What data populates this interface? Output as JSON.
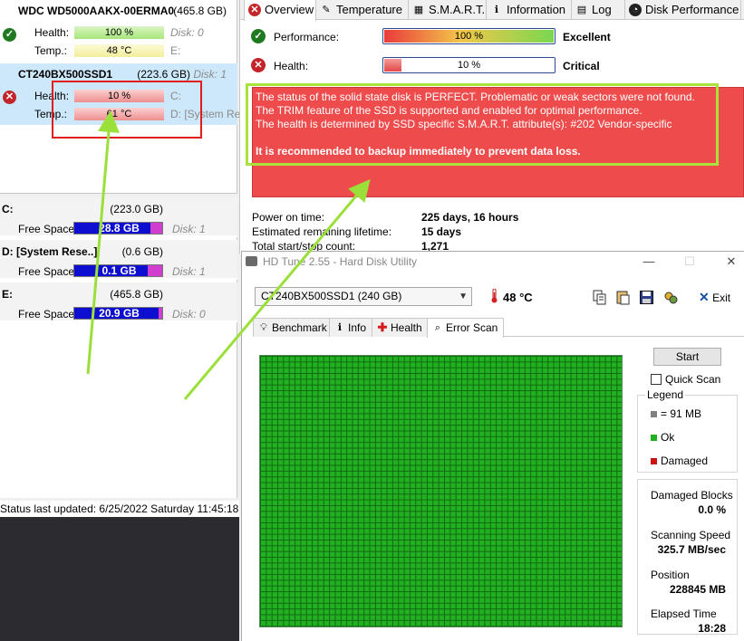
{
  "disks": [
    {
      "title": "WDC WD5000AAKX-00ERMA0",
      "size": "(465.8 GB)",
      "disk_label": "",
      "health_label": "Health:",
      "health_value": "100 %",
      "health_extra": "Disk: 0",
      "temp_label": "Temp.:",
      "temp_value": "48 °C",
      "temp_extra": "E:"
    },
    {
      "title": "CT240BX500SSD1",
      "size": "(223.6 GB)",
      "disk_label": "Disk: 1",
      "health_label": "Health:",
      "health_value": "10 %",
      "health_extra": "C:",
      "temp_label": "Temp.:",
      "temp_value": "61 °C",
      "temp_extra": "D: [System Re"
    }
  ],
  "partitions": [
    {
      "name": "C:",
      "size": "(223.0 GB)",
      "free_label": "Free Space",
      "free_value": "28.8 GB",
      "fill_percent": 87,
      "disk": "Disk: 1"
    },
    {
      "name": "D: [System Rese..]",
      "size": "(0.6 GB)",
      "free_label": "Free Space",
      "free_value": "0.1 GB",
      "fill_percent": 83,
      "disk": "Disk: 1"
    },
    {
      "name": "E:",
      "size": "(465.8 GB)",
      "free_label": "Free Space",
      "free_value": "20.9 GB",
      "fill_percent": 96,
      "disk": "Disk: 0"
    }
  ],
  "status_bar": "Status last updated: 6/25/2022 Saturday 11:45:18 AM",
  "tabs": [
    {
      "label": "Overview",
      "icon": "error-icon"
    },
    {
      "label": "Temperature",
      "icon": "thermometer-icon"
    },
    {
      "label": "S.M.A.R.T.",
      "icon": "smart-icon"
    },
    {
      "label": "Information",
      "icon": "info-icon"
    },
    {
      "label": "Log",
      "icon": "log-icon"
    },
    {
      "label": "Disk Performance",
      "icon": "speedometer-icon"
    }
  ],
  "performance": {
    "label": "Performance:",
    "value": "100 %",
    "percent": 100,
    "verdict": "Excellent"
  },
  "health": {
    "label": "Health:",
    "value": "10 %",
    "percent": 10,
    "verdict": "Critical"
  },
  "status_message": {
    "line1": "The status of the solid state disk is PERFECT. Problematic or weak sectors were not found.",
    "line2": "The TRIM feature of the SSD is supported and enabled for optimal performance.",
    "line3": "The health is determined by SSD specific S.M.A.R.T. attribute(s):  #202 Vendor-specific",
    "line4": "It is recommended to backup immediately to prevent data loss."
  },
  "info": {
    "power_on_label": "Power on time:",
    "power_on_value": "225 days, 16 hours",
    "lifetime_label": "Estimated remaining lifetime:",
    "lifetime_value": "15 days",
    "start_stop_label": "Total start/stop count:",
    "start_stop_value": "1,271"
  },
  "hdtune": {
    "title": "HD Tune 2.55 - Hard Disk Utility",
    "drive": "CT240BX500SSD1 (240 GB)",
    "temp": "48 °C",
    "exit_label": "Exit",
    "tabs": [
      "Benchmark",
      "Info",
      "Health",
      "Error Scan"
    ],
    "start_label": "Start",
    "quick_scan_label": "Quick Scan",
    "legend_title": "Legend",
    "legend_block": "= 91 MB",
    "legend_ok": "Ok",
    "legend_damaged": "Damaged",
    "damaged_blocks_label": "Damaged Blocks",
    "damaged_blocks_value": "0.0 %",
    "scan_speed_label": "Scanning Speed",
    "scan_speed_value": "325.7 MB/sec",
    "position_label": "Position",
    "position_value": "228845 MB",
    "elapsed_label": "Elapsed Time",
    "elapsed_value": "18:28"
  },
  "colors": {
    "status_red": "#ee4c4c",
    "highlight_green": "#a8e23a",
    "annotation_red": "#e01c1c",
    "scan_ok": "#22b022",
    "legend_block": "#808080",
    "legend_ok": "#22b022",
    "legend_damaged": "#cc1111"
  }
}
